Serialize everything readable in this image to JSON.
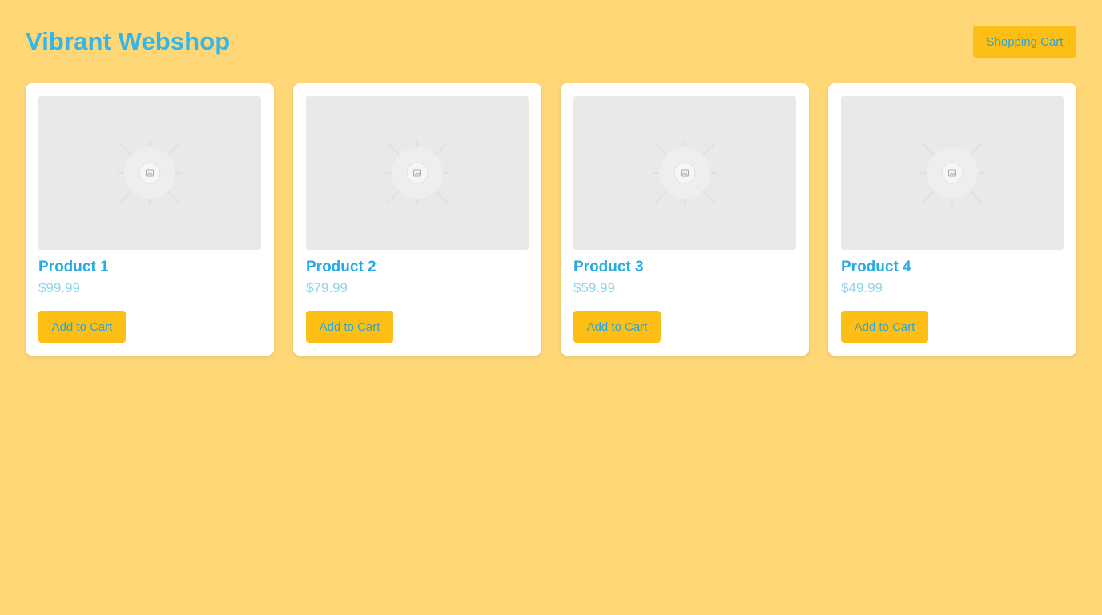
{
  "header": {
    "title": "Vibrant Webshop",
    "cart_label": "Shopping Cart"
  },
  "products": [
    {
      "name": "Product 1",
      "price": "$99.99",
      "button_label": "Add to Cart",
      "image_icon": "image-placeholder-icon"
    },
    {
      "name": "Product 2",
      "price": "$79.99",
      "button_label": "Add to Cart",
      "image_icon": "image-placeholder-icon"
    },
    {
      "name": "Product 3",
      "price": "$59.99",
      "button_label": "Add to Cart",
      "image_icon": "image-placeholder-icon"
    },
    {
      "name": "Product 4",
      "price": "$49.99",
      "button_label": "Add to Cart",
      "image_icon": "image-placeholder-icon"
    }
  ],
  "colors": {
    "background": "#FFD777",
    "accent": "#FDBF16",
    "title": "#36B6E8",
    "price": "#8DD3EC",
    "card": "#FFFFFF",
    "image_placeholder": "#E9E9E9"
  }
}
